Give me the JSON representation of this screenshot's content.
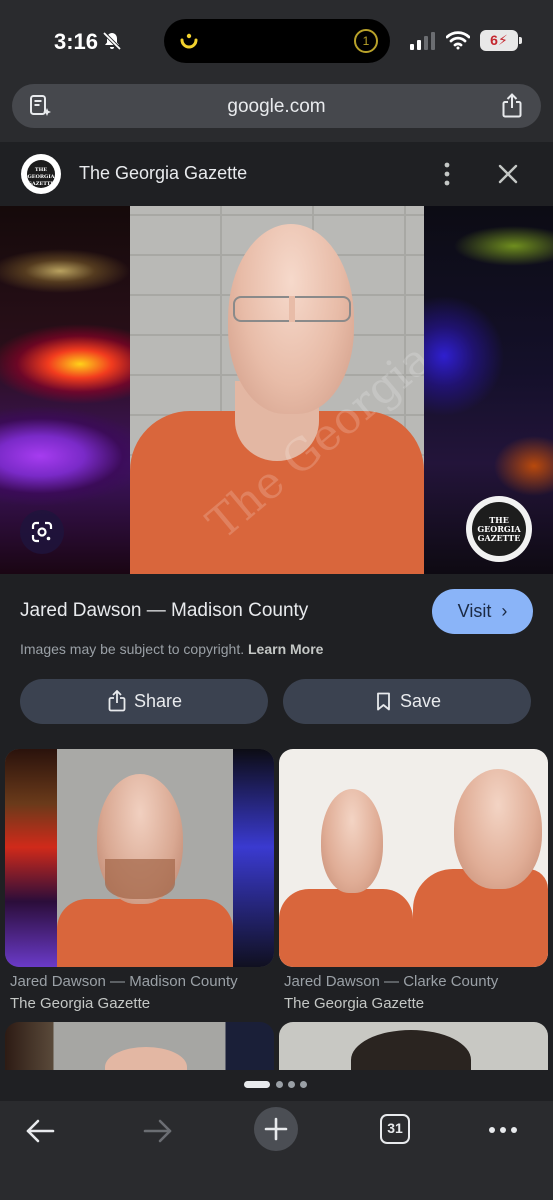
{
  "status_bar": {
    "time": "3:16",
    "battery": "6",
    "island_badge": "1"
  },
  "browser": {
    "url": "google.com"
  },
  "source": {
    "name": "The Georgia Gazette",
    "logo_text": "THE GEORGIA GAZETTE"
  },
  "main_image": {
    "watermark": "The Georgia Gazette",
    "seal_text": "THE GEORGIA GAZETTE"
  },
  "result": {
    "title": "Jared Dawson — Madison County",
    "visit_label": "Visit",
    "copyright_text": "Images may be subject to copyright.",
    "learn_more": "Learn More",
    "share_label": "Share",
    "save_label": "Save"
  },
  "related": [
    {
      "caption": "Jared Dawson — Madison County",
      "source": "The Georgia Gazette"
    },
    {
      "caption": "Jared Dawson — Clarke County",
      "source": "The Georgia Gazette"
    }
  ],
  "pagination": {
    "active_index": 0,
    "count": 4
  },
  "toolbar": {
    "tab_count": "31"
  },
  "colors": {
    "accent": "#8ab4f8",
    "button_bg": "#3b4250",
    "background": "#1f2023"
  }
}
